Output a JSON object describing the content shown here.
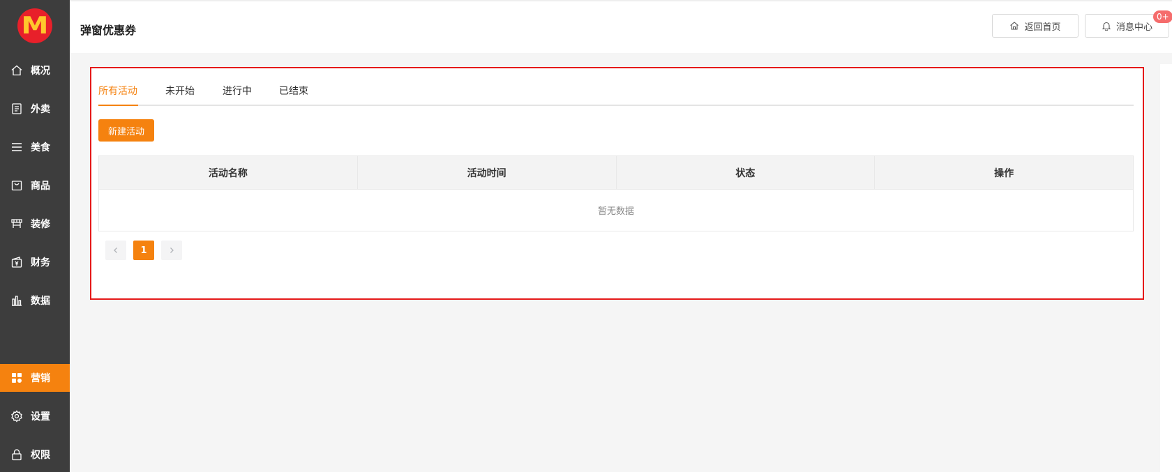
{
  "sidebar": {
    "logo": "M",
    "items": [
      {
        "label": "概况",
        "icon": "home-icon"
      },
      {
        "label": "外卖",
        "icon": "document-icon"
      },
      {
        "label": "美食",
        "icon": "list-icon"
      },
      {
        "label": "商品",
        "icon": "bag-icon"
      },
      {
        "label": "装修",
        "icon": "storefront-icon"
      },
      {
        "label": "财务",
        "icon": "wallet-icon"
      },
      {
        "label": "数据",
        "icon": "bar-chart-icon"
      },
      {
        "label": "营销",
        "icon": "apps-icon",
        "active": true
      },
      {
        "label": "设置",
        "icon": "gear-icon"
      },
      {
        "label": "权限",
        "icon": "lock-icon"
      }
    ]
  },
  "header": {
    "title": "弹窗优惠券",
    "home_label": "返回首页",
    "msg_label": "消息中心",
    "msg_badge": "0+"
  },
  "tabs": [
    "所有活动",
    "未开始",
    "进行中",
    "已结束"
  ],
  "new_button": "新建活动",
  "table": {
    "columns": [
      "活动名称",
      "活动时间",
      "状态",
      "操作"
    ],
    "empty_text": "暂无数据"
  },
  "pagination": {
    "current": "1"
  },
  "colors": {
    "accent": "#f5820f",
    "sidebar": "#3d3d3d",
    "highlight_border": "#e51919"
  }
}
